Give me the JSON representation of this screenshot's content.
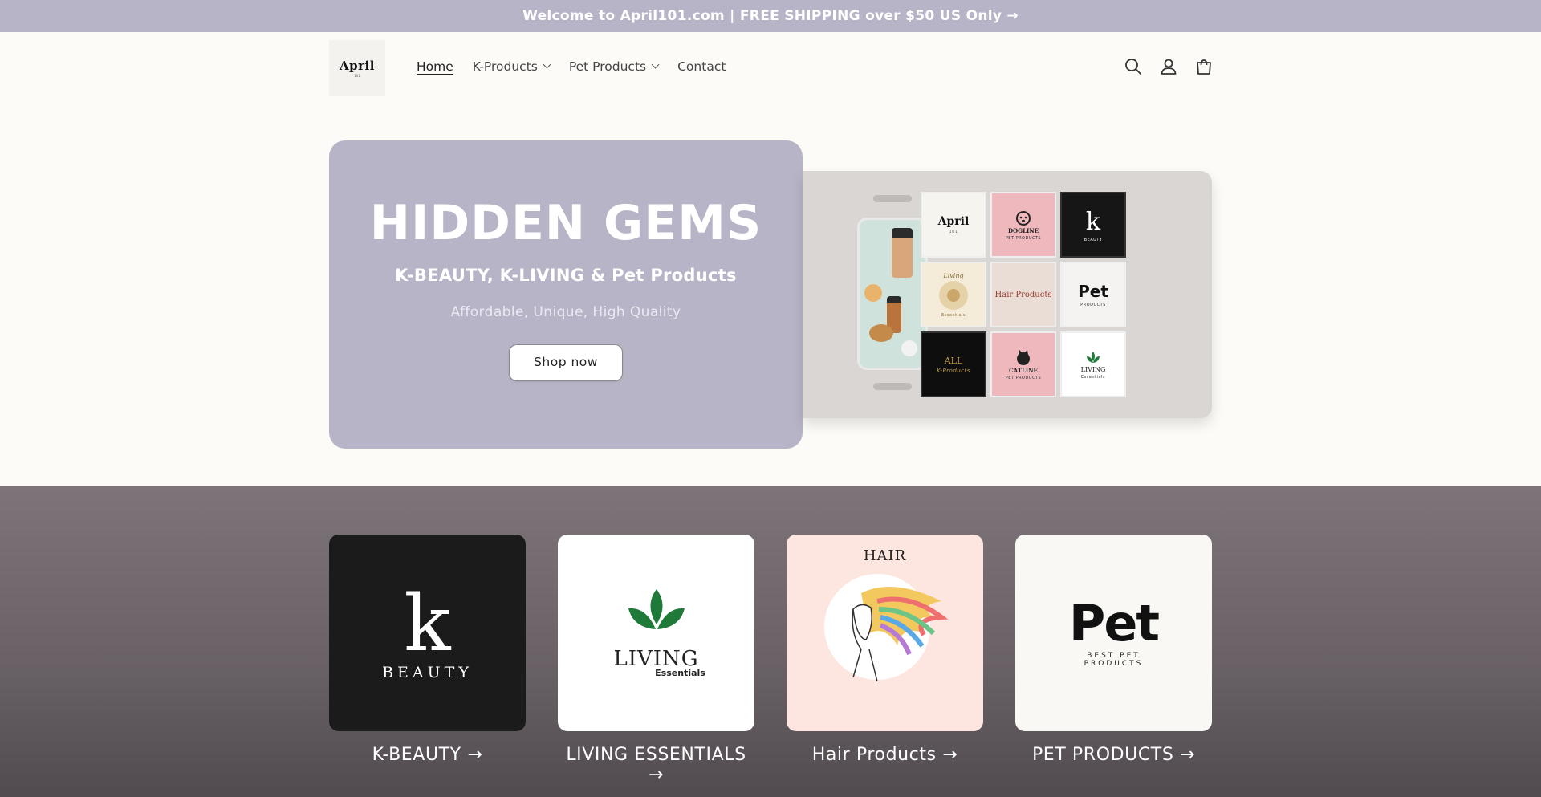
{
  "announcement": {
    "text": "Welcome to April101.com | FREE SHIPPING over $50 US Only",
    "arrow": "→"
  },
  "header": {
    "logo": {
      "text": "April",
      "sub": "101"
    },
    "nav": [
      {
        "label": "Home",
        "active": true,
        "dropdown": false
      },
      {
        "label": "K-Products",
        "active": false,
        "dropdown": true
      },
      {
        "label": "Pet Products",
        "active": false,
        "dropdown": true
      },
      {
        "label": "Contact",
        "active": false,
        "dropdown": false
      }
    ],
    "icons": [
      "search-icon",
      "account-icon",
      "cart-icon"
    ]
  },
  "hero": {
    "title": "HIDDEN GEMS",
    "subtitle": "K-BEAUTY, K-LIVING & Pet Products",
    "tagline": "Affordable, Unique, High Quality",
    "button_label": "Shop now",
    "card_color": "#b8b4c8"
  },
  "collage": {
    "tiles": {
      "april": {
        "title": "April",
        "sub": "101"
      },
      "dogline": {
        "title": "DOGLINE",
        "sub": "PET PRODUCTS"
      },
      "kbeauty": {
        "title": "k",
        "sub": "BEAUTY"
      },
      "essentials": {
        "title": "Living",
        "sub": "Essentials"
      },
      "hair": {
        "title": "Hair Products",
        "sub": ""
      },
      "pet": {
        "title": "Pet",
        "sub": "PRODUCTS"
      },
      "all": {
        "title": "ALL",
        "sub": "K-Products"
      },
      "catline": {
        "title": "CATLINE",
        "sub": "PET PRODUCTS"
      },
      "living": {
        "title": "LIVING",
        "sub": "Essentials"
      }
    }
  },
  "collections": [
    {
      "label": "K-BEAUTY",
      "arrow": "→",
      "image": {
        "title": "k",
        "sub": "BEAUTY"
      },
      "bg": "#1c1b1c"
    },
    {
      "label": "LIVING ESSENTIALS",
      "arrow": "→",
      "image": {
        "title": "LIVING",
        "sub": "Essentials"
      },
      "bg": "#ffffff"
    },
    {
      "label": "Hair Products",
      "arrow": "→",
      "image": {
        "title": "HAIR",
        "sub": ""
      },
      "bg": "#fde6e0"
    },
    {
      "label": "PET PRODUCTS",
      "arrow": "→",
      "image": {
        "title": "Pet",
        "sub": "BEST PET PRODUCTS"
      },
      "bg": "#faf8f5"
    }
  ],
  "colors": {
    "accent": "#b8b4c8",
    "background": "#fdfbf7",
    "collections_bg": "#6a6266"
  }
}
